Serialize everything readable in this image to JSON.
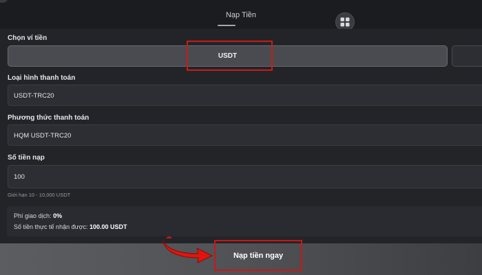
{
  "header": {
    "title": "Nạp Tiền",
    "grid_icon": "grid-icon"
  },
  "wallet": {
    "label": "Chọn ví tiền",
    "selected": "USDT"
  },
  "payment_type": {
    "label": "Loại hình thanh toán",
    "value": "USDT-TRC20"
  },
  "payment_method": {
    "label": "Phương thức thanh toán",
    "value": "HQM USDT-TRC20"
  },
  "amount": {
    "label": "Số tiền nạp",
    "value": "100",
    "limit_hint": "Giới hạn 10 - 10,000 USDT"
  },
  "summary": {
    "fee_label": "Phí giao dịch:",
    "fee_value": "0%",
    "received_label": "Số tiền thực tế nhận được:",
    "received_value": "100.00 USDT"
  },
  "submit_label": "Nạp tiền ngay",
  "colors": {
    "highlight": "#cc1a16",
    "arrow": "#e0150f"
  }
}
